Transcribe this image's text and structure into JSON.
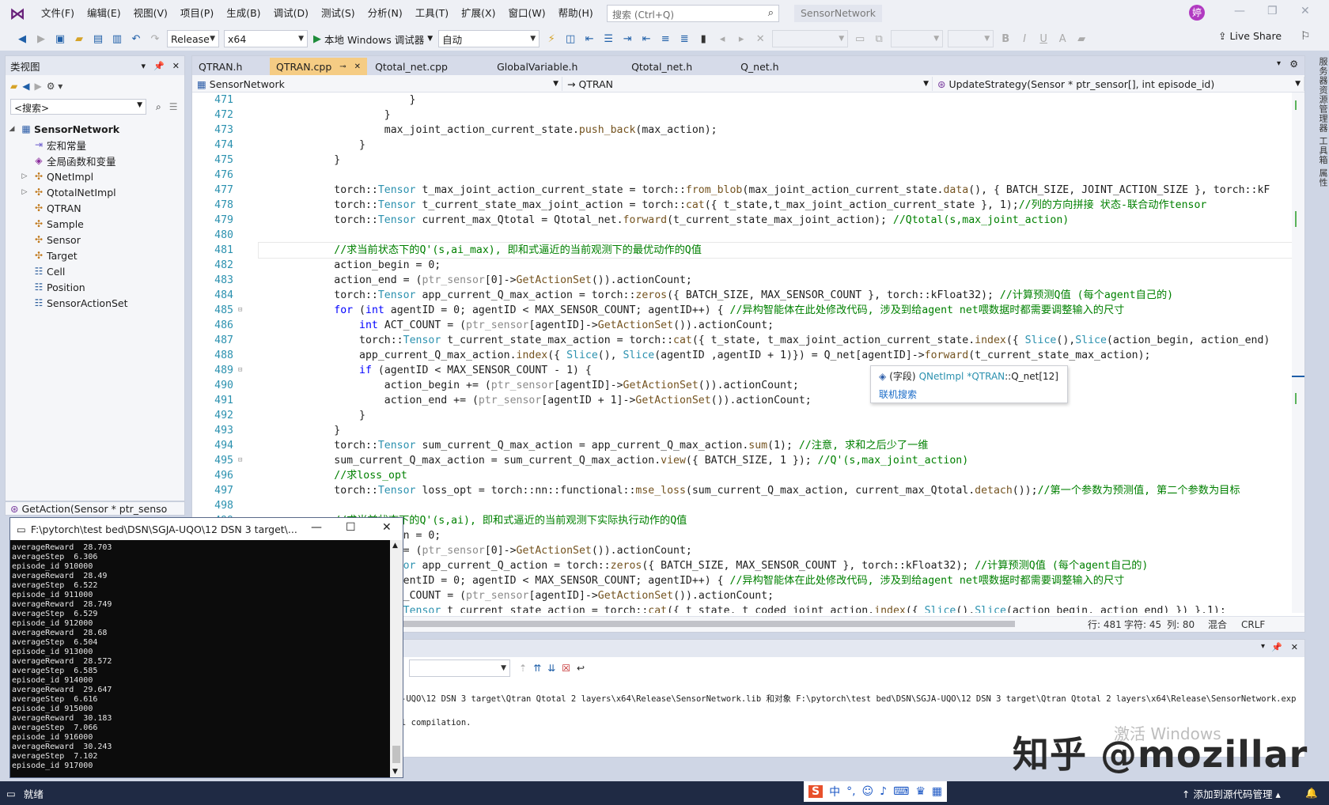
{
  "menubar": {
    "items": [
      "文件(F)",
      "编辑(E)",
      "视图(V)",
      "项目(P)",
      "生成(B)",
      "调试(D)",
      "测试(S)",
      "分析(N)",
      "工具(T)",
      "扩展(X)",
      "窗口(W)",
      "帮助(H)"
    ],
    "search_placeholder": "搜索 (Ctrl+Q)",
    "solution_name": "SensorNetwork",
    "avatar_letter": "婷"
  },
  "toolbar": {
    "config": "Release",
    "platform": "x64",
    "run_label": "本地 Windows 调试器",
    "run_mode": "自动",
    "live_share": "Live Share"
  },
  "class_view": {
    "title": "类视图",
    "search_text": "<搜索>",
    "root": "SensorNetwork",
    "items": [
      {
        "label": "宏和常量",
        "icon": "macro-icon"
      },
      {
        "label": "全局函数和变量",
        "icon": "global-icon"
      },
      {
        "label": "QNetImpl",
        "icon": "class-icon",
        "expandable": true
      },
      {
        "label": "QtotalNetImpl",
        "icon": "class-icon",
        "expandable": true
      },
      {
        "label": "QTRAN",
        "icon": "class-icon"
      },
      {
        "label": "Sample",
        "icon": "class-icon"
      },
      {
        "label": "Sensor",
        "icon": "class-icon"
      },
      {
        "label": "Target",
        "icon": "class-icon"
      },
      {
        "label": "Cell",
        "icon": "struct-icon"
      },
      {
        "label": "Position",
        "icon": "struct-icon"
      },
      {
        "label": "SensorActionSet",
        "icon": "struct-icon"
      }
    ],
    "member_entry": "GetAction(Sensor * ptr_senso"
  },
  "editor": {
    "tabs": [
      {
        "label": "QTRAN.h",
        "active": false
      },
      {
        "label": "QTRAN.cpp",
        "active": true
      },
      {
        "label": "Qtotal_net.cpp",
        "active": false
      },
      {
        "label": "GlobalVariable.h",
        "active": false
      },
      {
        "label": "Qtotal_net.h",
        "active": false
      },
      {
        "label": "Q_net.h",
        "active": false
      }
    ],
    "nav_project": "SensorNetwork",
    "nav_class": "QTRAN",
    "nav_member": "UpdateStrategy(Sensor * ptr_sensor[], int episode_id)",
    "status": {
      "line": "行: 481",
      "char": "字符: 45",
      "col": "列: 80",
      "mode": "混合",
      "eol": "CRLF"
    }
  },
  "code_lines": [
    {
      "n": "471",
      "html": "                        }"
    },
    {
      "n": "472",
      "html": "                    }"
    },
    {
      "n": "473",
      "html": "                    max_joint_action_current_state.<span class=\"fn\">push_back</span>(max_action);"
    },
    {
      "n": "474",
      "html": "                }"
    },
    {
      "n": "475",
      "html": "            }"
    },
    {
      "n": "476",
      "html": ""
    },
    {
      "n": "477",
      "html": "            torch::<span class=\"ty\">Tensor</span> t_max_joint_action_current_state = torch::<span class=\"fn\">from_blob</span>(max_joint_action_current_state.<span class=\"fn\">data</span>(), { BATCH_SIZE, JOINT_ACTION_SIZE }, torch::kF"
    },
    {
      "n": "478",
      "html": "            torch::<span class=\"ty\">Tensor</span> t_current_state_max_joint_action = torch::<span class=\"fn\">cat</span>({ t_state,t_max_joint_action_current_state }, 1);<span class=\"cm\">//列的方向拼接 状态-联合动作tensor</span>"
    },
    {
      "n": "479",
      "html": "            torch::<span class=\"ty\">Tensor</span> current_max_Qtotal = Qtotal_net.<span class=\"fn\">forward</span>(t_current_state_max_joint_action); <span class=\"cm\">//Qtotal(s,max_joint_action)</span>"
    },
    {
      "n": "480",
      "html": ""
    },
    {
      "n": "481",
      "html": "            <span class=\"cm\">//求当前状态下的Q'(s,ai_max), 即和式逼近的当前观测下的最优动作的Q值</span>",
      "current": true
    },
    {
      "n": "482",
      "html": "            action_begin = 0;"
    },
    {
      "n": "483",
      "html": "            action_end = (<span class=\"gl\">ptr_sensor</span>[0]-><span class=\"fn\">GetActionSet</span>()).actionCount;"
    },
    {
      "n": "484",
      "html": "            torch::<span class=\"ty\">Tensor</span> app_current_Q_max_action = torch::<span class=\"fn\">zeros</span>({ BATCH_SIZE, MAX_SENSOR_COUNT }, torch::kFloat32); <span class=\"cm\">//计算预测Q值 (每个agent自己的)</span>"
    },
    {
      "n": "485",
      "html": "            <span class=\"kw\">for</span> (<span class=\"kw\">int</span> agentID = 0; agentID < MAX_SENSOR_COUNT; agentID++) { <span class=\"cm\">//异构智能体在此处修改代码, 涉及到给agent net喂数据时都需要调整输入的尺寸</span>",
      "fold": true
    },
    {
      "n": "486",
      "html": "                <span class=\"kw\">int</span> ACT_COUNT = (<span class=\"gl\">ptr_sensor</span>[agentID]-><span class=\"fn\">GetActionSet</span>()).actionCount;"
    },
    {
      "n": "487",
      "html": "                torch::<span class=\"ty\">Tensor</span> t_current_state_max_action = torch::<span class=\"fn\">cat</span>({ t_state, t_max_joint_action_current_state.<span class=\"fn\">index</span>({ <span class=\"ty\">Slice</span>(),<span class=\"ty\">Slice</span>(action_begin, action_end)"
    },
    {
      "n": "488",
      "html": "                app_current_Q_max_action.<span class=\"fn\">index</span>({ <span class=\"ty\">Slice</span>(), <span class=\"ty\">Slice</span>(agentID ,agentID + 1)}) = Q_net[agentID]-><span class=\"fn\">forward</span>(t_current_state_max_action);"
    },
    {
      "n": "489",
      "html": "                <span class=\"kw\">if</span> (agentID < MAX_SENSOR_COUNT - 1) {",
      "fold": true
    },
    {
      "n": "490",
      "html": "                    action_begin += (<span class=\"gl\">ptr_sensor</span>[agentID]-><span class=\"fn\">GetActionSet</span>()).actionCount;"
    },
    {
      "n": "491",
      "html": "                    action_end += (<span class=\"gl\">ptr_sensor</span>[agentID + 1]-><span class=\"fn\">GetActionSet</span>()).actionCount;"
    },
    {
      "n": "492",
      "html": "                }"
    },
    {
      "n": "493",
      "html": "            }"
    },
    {
      "n": "494",
      "html": "            torch::<span class=\"ty\">Tensor</span> sum_current_Q_max_action = app_current_Q_max_action.<span class=\"fn\">sum</span>(1); <span class=\"cm\">//注意, 求和之后少了一维</span>"
    },
    {
      "n": "495",
      "html": "            sum_current_Q_max_action = sum_current_Q_max_action.<span class=\"fn\">view</span>({ BATCH_SIZE, 1 }); <span class=\"cm\">//Q'(s,max_joint_action)</span>",
      "fold": true
    },
    {
      "n": "496",
      "html": "            <span class=\"cm\">//求loss_opt</span>"
    },
    {
      "n": "497",
      "html": "            torch::<span class=\"ty\">Tensor</span> loss_opt = torch::nn::functional::<span class=\"fn\">mse_loss</span>(sum_current_Q_max_action, current_max_Qtotal.<span class=\"fn\">detach</span>());<span class=\"cm\">//第一个参数为预测值, 第二个参数为目标</span>"
    },
    {
      "n": "498",
      "html": ""
    },
    {
      "n": "499",
      "html": "            <span class=\"cm\">//求当前状态下的Q'(s,ai), 即和式逼近的当前观测下实际执行动作的Q值</span>"
    },
    {
      "n": "500",
      "html": "            action_begin = 0;"
    },
    {
      "n": "501",
      "html": "            action_end = (<span class=\"gl\">ptr_sensor</span>[0]-><span class=\"fn\">GetActionSet</span>()).actionCount;"
    },
    {
      "n": "502",
      "html": "            torch::<span class=\"ty\">Tensor</span> app_current_Q_action = torch::<span class=\"fn\">zeros</span>({ BATCH_SIZE, MAX_SENSOR_COUNT }, torch::kFloat32); <span class=\"cm\">//计算预测Q值 (每个agent自己的)</span>"
    },
    {
      "n": "503",
      "html": "            <span class=\"kw\">for</span> (<span class=\"kw\">int</span> agentID = 0; agentID < MAX_SENSOR_COUNT; agentID++) { <span class=\"cm\">//异构智能体在此处修改代码, 涉及到给agent net喂数据时都需要调整输入的尺寸</span>"
    },
    {
      "n": "504",
      "html": "                <span class=\"kw\">int</span> ACT_COUNT = (<span class=\"gl\">ptr_sensor</span>[agentID]-><span class=\"fn\">GetActionSet</span>()).actionCount;"
    },
    {
      "n": "505",
      "html": "                torch::<span class=\"ty\">Tensor</span> t_current_state_action = torch::<span class=\"fn\">cat</span>({ t_state, t_coded_joint_action.<span class=\"fn\">index</span>({ <span class=\"ty\">Slice</span>(),<span class=\"ty\">Slice</span>(action_begin, action_end) }) },1);"
    }
  ],
  "tooltip": {
    "kind": "(字段)",
    "type": "QNetImpl",
    "owner": "*QTRAN",
    "member": "::Q_net[12]",
    "link": "联机搜索"
  },
  "output": {
    "line1": "-UQO\\12 DSN 3 target\\Qtran Qtotal 2 layers\\x64\\Release\\SensorNetwork.lib 和对象 F:\\pytorch\\test bed\\DSN\\SGJA-UQO\\12 DSN 3 target\\Qtran Qtotal 2 layers\\x64\\Release\\SensorNetwork.exp",
    "line2": "l compilation."
  },
  "console": {
    "title": "F:\\pytorch\\test bed\\DSN\\SGJA-UQO\\12 DSN 3 target\\...",
    "lines": [
      "averageReward  28.703",
      "averageStep  6.306",
      "episode_id 910000",
      "averageReward  28.49",
      "averageStep  6.522",
      "episode_id 911000",
      "averageReward  28.749",
      "averageStep  6.529",
      "episode_id 912000",
      "averageReward  28.68",
      "averageStep  6.504",
      "episode_id 913000",
      "averageReward  28.572",
      "averageStep  6.585",
      "episode_id 914000",
      "averageReward  29.647",
      "averageStep  6.616",
      "episode_id 915000",
      "averageReward  30.183",
      "averageStep  7.066",
      "episode_id 916000",
      "averageReward  30.243",
      "averageStep  7.102",
      "episode_id 917000"
    ]
  },
  "statusbar": {
    "ready": "就绪",
    "source_control": "添加到源代码管理",
    "ime": "中"
  },
  "watermark": "知乎 @mozillar",
  "activate_text": "激活 Windows",
  "right_sidebar": "服务器资源管理器 工具箱 属性"
}
